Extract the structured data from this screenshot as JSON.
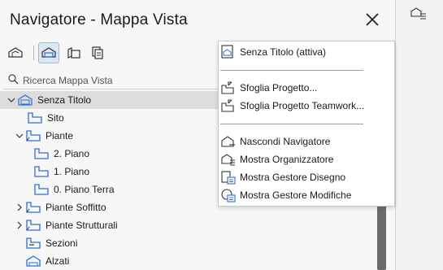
{
  "window": {
    "title": "Navigatore - Mappa Vista"
  },
  "toolbar": {
    "buttons": [
      {
        "icon": "project-map-icon"
      },
      {
        "icon": "view-map-icon",
        "active": true
      },
      {
        "icon": "layout-book-icon"
      },
      {
        "icon": "publisher-sets-icon"
      }
    ]
  },
  "search": {
    "placeholder": "Ricerca Mappa Vista"
  },
  "tree": {
    "items": [
      {
        "label": "Senza Titolo",
        "icon": "project-root-icon",
        "expanded": true,
        "selected": true
      },
      {
        "label": "Sito",
        "icon": "folder-view-icon"
      },
      {
        "label": "Piante",
        "icon": "folder-view-icon",
        "expanded": true
      },
      {
        "label": "2. Piano",
        "icon": "folder-view-icon"
      },
      {
        "label": "1. Piano",
        "icon": "folder-view-icon"
      },
      {
        "label": "0. Piano Terra",
        "icon": "folder-view-icon"
      },
      {
        "label": "Piante Soffitto",
        "icon": "folder-view-icon",
        "expanded": false
      },
      {
        "label": "Piante Strutturali",
        "icon": "folder-view-icon",
        "expanded": false
      },
      {
        "label": "Sezioni",
        "icon": "section-icon"
      },
      {
        "label": "Alzati",
        "icon": "elevation-icon"
      }
    ]
  },
  "menu": {
    "items": [
      {
        "label": "Senza Titolo (attiva)",
        "icon": "project-file-icon"
      },
      {
        "label": "Sfoglia Progetto...",
        "icon": "browse-project-icon"
      },
      {
        "label": "Sfoglia Progetto Teamwork...",
        "icon": "browse-teamwork-icon"
      },
      {
        "label": "Nascondi Navigatore",
        "icon": "hide-navigator-icon"
      },
      {
        "label": "Mostra Organizzatore",
        "icon": "organizer-icon"
      },
      {
        "label": "Mostra Gestore Disegno",
        "icon": "drawing-manager-icon"
      },
      {
        "label": "Mostra Gestore Modifiche",
        "icon": "change-manager-icon"
      }
    ]
  },
  "colors": {
    "accent_blue": "#2d6fd2",
    "highlight_red": "#e0201f",
    "selection_gray": "#dcdcdc"
  }
}
